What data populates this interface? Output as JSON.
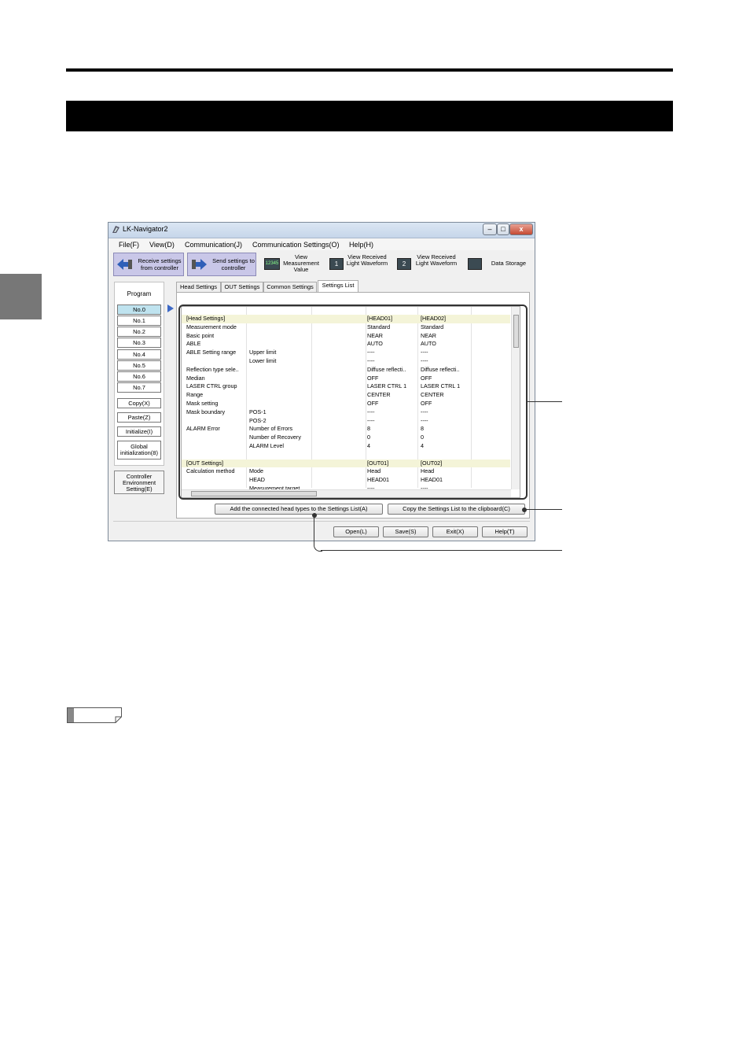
{
  "window": {
    "title": "LK-Navigator2",
    "caption_buttons": {
      "minimize": "–",
      "maximize": "□",
      "close": "x"
    }
  },
  "menu": [
    "File(F)",
    "View(D)",
    "Communication(J)",
    "Communication Settings(O)",
    "Help(H)"
  ],
  "toolbar": {
    "receive": "Receive settings from controller",
    "send": "Send settings to controller",
    "view_measurement": "View Measurement Value",
    "view_measurement_icon": "12345",
    "view_waveform1": "View Received Light Waveform",
    "view_waveform1_icon": "1",
    "view_waveform2": "View Received Light Waveform",
    "view_waveform2_icon": "2",
    "data_storage": "Data Storage"
  },
  "program": {
    "label": "Program",
    "items": [
      "No.0",
      "No.1",
      "No.2",
      "No.3",
      "No.4",
      "No.5",
      "No.6",
      "No.7"
    ],
    "selected": "No.0",
    "copy": "Copy(X)",
    "paste": "Paste(Z)",
    "initialize": "Initialize(I)",
    "global_init": "Global initialization(8)",
    "controller_env": "Controller Environment Setting(E)"
  },
  "tabs": [
    "Head Settings",
    "OUT Settings",
    "Common Settings",
    "Settings List"
  ],
  "active_tab": "Settings List",
  "settings_rows": [
    {
      "c1": "[Head Settings]",
      "c2": "",
      "c3": "[HEAD01]",
      "c4": "[HEAD02]",
      "band": true
    },
    {
      "c1": "Measurement mode",
      "c2": "",
      "c3": "Standard",
      "c4": "Standard"
    },
    {
      "c1": "Basic point",
      "c2": "",
      "c3": "NEAR",
      "c4": "NEAR"
    },
    {
      "c1": "ABLE",
      "c2": "",
      "c3": "AUTO",
      "c4": "AUTO"
    },
    {
      "c1": "ABLE Setting range",
      "c2": "Upper limit",
      "c3": "----",
      "c4": "----"
    },
    {
      "c1": "",
      "c2": "Lower limit",
      "c3": "----",
      "c4": "----"
    },
    {
      "c1": "Reflection type sele..",
      "c2": "",
      "c3": "Diffuse reflecti..",
      "c4": "Diffuse reflecti.."
    },
    {
      "c1": "Median",
      "c2": "",
      "c3": "OFF",
      "c4": "OFF"
    },
    {
      "c1": "LASER CTRL group",
      "c2": "",
      "c3": "LASER CTRL 1",
      "c4": "LASER CTRL 1"
    },
    {
      "c1": "Range",
      "c2": "",
      "c3": "CENTER",
      "c4": "CENTER"
    },
    {
      "c1": "Mask setting",
      "c2": "",
      "c3": "OFF",
      "c4": "OFF"
    },
    {
      "c1": "Mask boundary",
      "c2": "POS-1",
      "c3": "----",
      "c4": "----"
    },
    {
      "c1": "",
      "c2": "POS-2",
      "c3": "----",
      "c4": "----"
    },
    {
      "c1": "ALARM Error",
      "c2": "Number of Errors",
      "c3": "8",
      "c4": "8"
    },
    {
      "c1": "",
      "c2": "Number of Recovery",
      "c3": "0",
      "c4": "0"
    },
    {
      "c1": "",
      "c2": "ALARM Level",
      "c3": "4",
      "c4": "4"
    },
    {
      "c1": "",
      "c2": "",
      "c3": "",
      "c4": ""
    },
    {
      "c1": "[OUT Settings]",
      "c2": "",
      "c3": "[OUT01]",
      "c4": "[OUT02]",
      "band": true
    },
    {
      "c1": "Calculation method",
      "c2": "Mode",
      "c3": "Head",
      "c4": "Head"
    },
    {
      "c1": "",
      "c2": "HEAD",
      "c3": "HEAD01",
      "c4": "HEAD01"
    },
    {
      "c1": "",
      "c2": "Measurement target",
      "c3": "----",
      "c4": "----"
    }
  ],
  "list_buttons": {
    "add_head_types": "Add the connected head types to the Settings List(A)",
    "copy_clipboard": "Copy the Settings List to the clipboard(C)"
  },
  "bottom_buttons": {
    "open": "Open(L)",
    "save": "Save(S)",
    "exit": "Exit(X)",
    "help": "Help(T)"
  },
  "colors": {
    "title_bar": "#000000",
    "toolbar_button": "#c9c7e8",
    "selected_program": "#bfe3ef",
    "row_band": "#f4f4d8",
    "arrow": "#3d69c6"
  }
}
